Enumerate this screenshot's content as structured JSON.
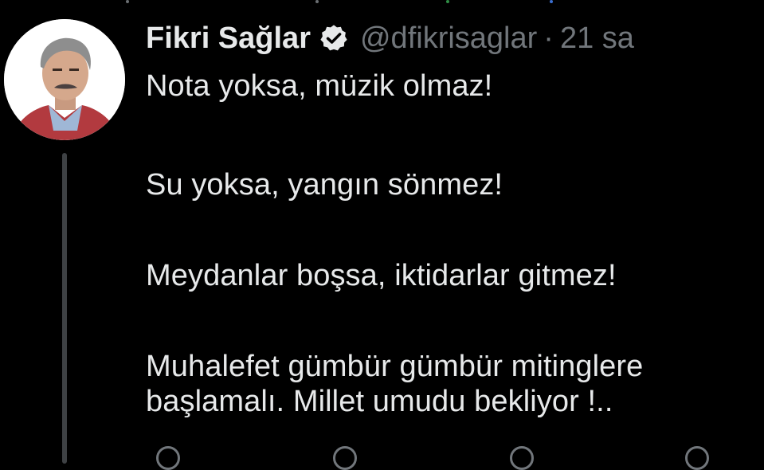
{
  "tweet": {
    "display_name": "Fikri Sağlar",
    "handle": "@dfikrisaglar",
    "separator": "·",
    "time": "21 sa",
    "paragraphs": [
      "Nota yoksa, müzik olmaz!",
      "Su yoksa, yangın sönmez!",
      "Meydanlar boşsa, iktidarlar gitmez!"
    ],
    "last_paragraph_lines": [
      "Muhalefet gümbür gümbür mitinglere",
      "başlamalı. Millet umudu bekliyor !.."
    ]
  },
  "icons": {
    "avatar": "avatar-photo",
    "verified": "verified-badge-icon"
  },
  "colors": {
    "background": "#000000",
    "text_primary": "#e7e9ea",
    "text_secondary": "#71767b",
    "thread_line": "#3e4144"
  }
}
